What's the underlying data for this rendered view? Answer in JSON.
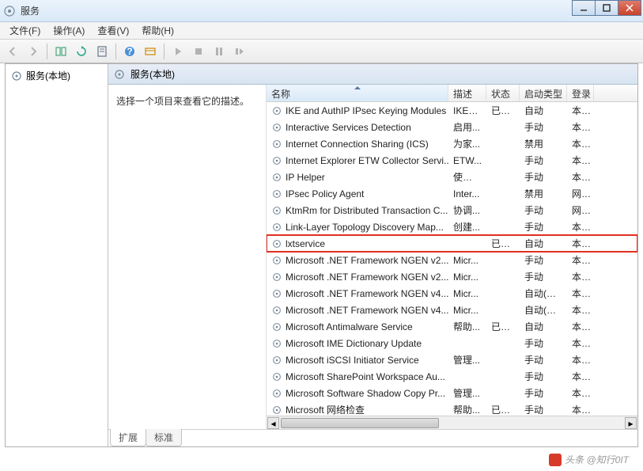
{
  "window": {
    "title": "服务"
  },
  "menu": {
    "file": "文件(F)",
    "action": "操作(A)",
    "view": "查看(V)",
    "help": "帮助(H)"
  },
  "tree": {
    "root": "服务(本地)"
  },
  "panel": {
    "header": "服务(本地)",
    "detail_hint": "选择一个项目来查看它的描述。"
  },
  "columns": {
    "name": "名称",
    "desc": "描述",
    "status": "状态",
    "startup": "启动类型",
    "logon": "登录"
  },
  "tabs": {
    "extended": "扩展",
    "standard": "标准"
  },
  "watermark": "头条 @知行0IT",
  "highlight_index": 8,
  "services": [
    {
      "name": "IKE and AuthIP IPsec Keying Modules",
      "desc": "IKEE...",
      "status": "已启动",
      "startup": "自动",
      "logon": "本地"
    },
    {
      "name": "Interactive Services Detection",
      "desc": "启用...",
      "status": "",
      "startup": "手动",
      "logon": "本地"
    },
    {
      "name": "Internet Connection Sharing (ICS)",
      "desc": "为家...",
      "status": "",
      "startup": "禁用",
      "logon": "本地"
    },
    {
      "name": "Internet Explorer ETW Collector Servi...",
      "desc": "ETW...",
      "status": "",
      "startup": "手动",
      "logon": "本地"
    },
    {
      "name": "IP Helper",
      "desc": "使用 ...",
      "status": "",
      "startup": "手动",
      "logon": "本地"
    },
    {
      "name": "IPsec Policy Agent",
      "desc": "Inter...",
      "status": "",
      "startup": "禁用",
      "logon": "网络"
    },
    {
      "name": "KtmRm for Distributed Transaction C...",
      "desc": "协调...",
      "status": "",
      "startup": "手动",
      "logon": "网络"
    },
    {
      "name": "Link-Layer Topology Discovery Map...",
      "desc": "创建...",
      "status": "",
      "startup": "手动",
      "logon": "本地"
    },
    {
      "name": "lxtservice",
      "desc": "",
      "status": "已启动",
      "startup": "自动",
      "logon": "本地"
    },
    {
      "name": "Microsoft .NET Framework NGEN v2...",
      "desc": "Micr...",
      "status": "",
      "startup": "手动",
      "logon": "本地"
    },
    {
      "name": "Microsoft .NET Framework NGEN v2...",
      "desc": "Micr...",
      "status": "",
      "startup": "手动",
      "logon": "本地"
    },
    {
      "name": "Microsoft .NET Framework NGEN v4...",
      "desc": "Micr...",
      "status": "",
      "startup": "自动(延迟...",
      "logon": "本地"
    },
    {
      "name": "Microsoft .NET Framework NGEN v4...",
      "desc": "Micr...",
      "status": "",
      "startup": "自动(延迟...",
      "logon": "本地"
    },
    {
      "name": "Microsoft Antimalware Service",
      "desc": "帮助...",
      "status": "已启动",
      "startup": "自动",
      "logon": "本地"
    },
    {
      "name": "Microsoft IME Dictionary Update",
      "desc": "",
      "status": "",
      "startup": "手动",
      "logon": "本地"
    },
    {
      "name": "Microsoft iSCSI Initiator Service",
      "desc": "管理...",
      "status": "",
      "startup": "手动",
      "logon": "本地"
    },
    {
      "name": "Microsoft SharePoint Workspace Au...",
      "desc": "",
      "status": "",
      "startup": "手动",
      "logon": "本地"
    },
    {
      "name": "Microsoft Software Shadow Copy Pr...",
      "desc": "管理...",
      "status": "",
      "startup": "手动",
      "logon": "本地"
    },
    {
      "name": "Microsoft 网络检查",
      "desc": "帮助...",
      "status": "已启动",
      "startup": "手动",
      "logon": "本地"
    }
  ]
}
